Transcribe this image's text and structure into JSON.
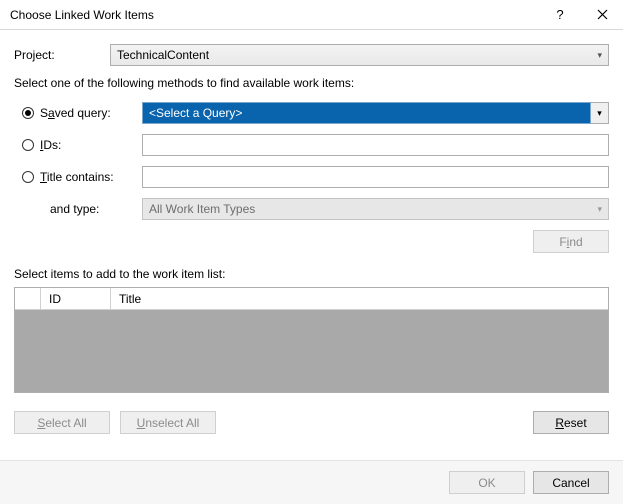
{
  "titlebar": {
    "title": "Choose Linked Work Items"
  },
  "labels": {
    "project": "Project:",
    "instruction": "Select one of the following methods to find available work items:",
    "savedQueryPre": "S",
    "savedQueryU": "a",
    "savedQueryPost": "ved query:",
    "idsU": "I",
    "idsPost": "Ds:",
    "titleContainsU": "T",
    "titleContainsPost": "itle contains:",
    "andType": "and type:",
    "findPre": "F",
    "findU": "i",
    "findPost": "nd",
    "selectItems": "Select items to add to the work item list:",
    "gridId": "ID",
    "gridTitle": "Title",
    "selectAllU": "S",
    "selectAllPost": "elect All",
    "unselectAllU": "U",
    "unselectAllPost": "nselect All",
    "resetU": "R",
    "resetPost": "eset",
    "ok": "OK",
    "cancel": "Cancel"
  },
  "project": {
    "value": "TechnicalContent"
  },
  "methods": {
    "savedQuerySelected": true,
    "querySelectPlaceholder": "<Select a Query>",
    "idsValue": "",
    "titleContainsValue": "",
    "typeValue": "All Work Item Types"
  }
}
